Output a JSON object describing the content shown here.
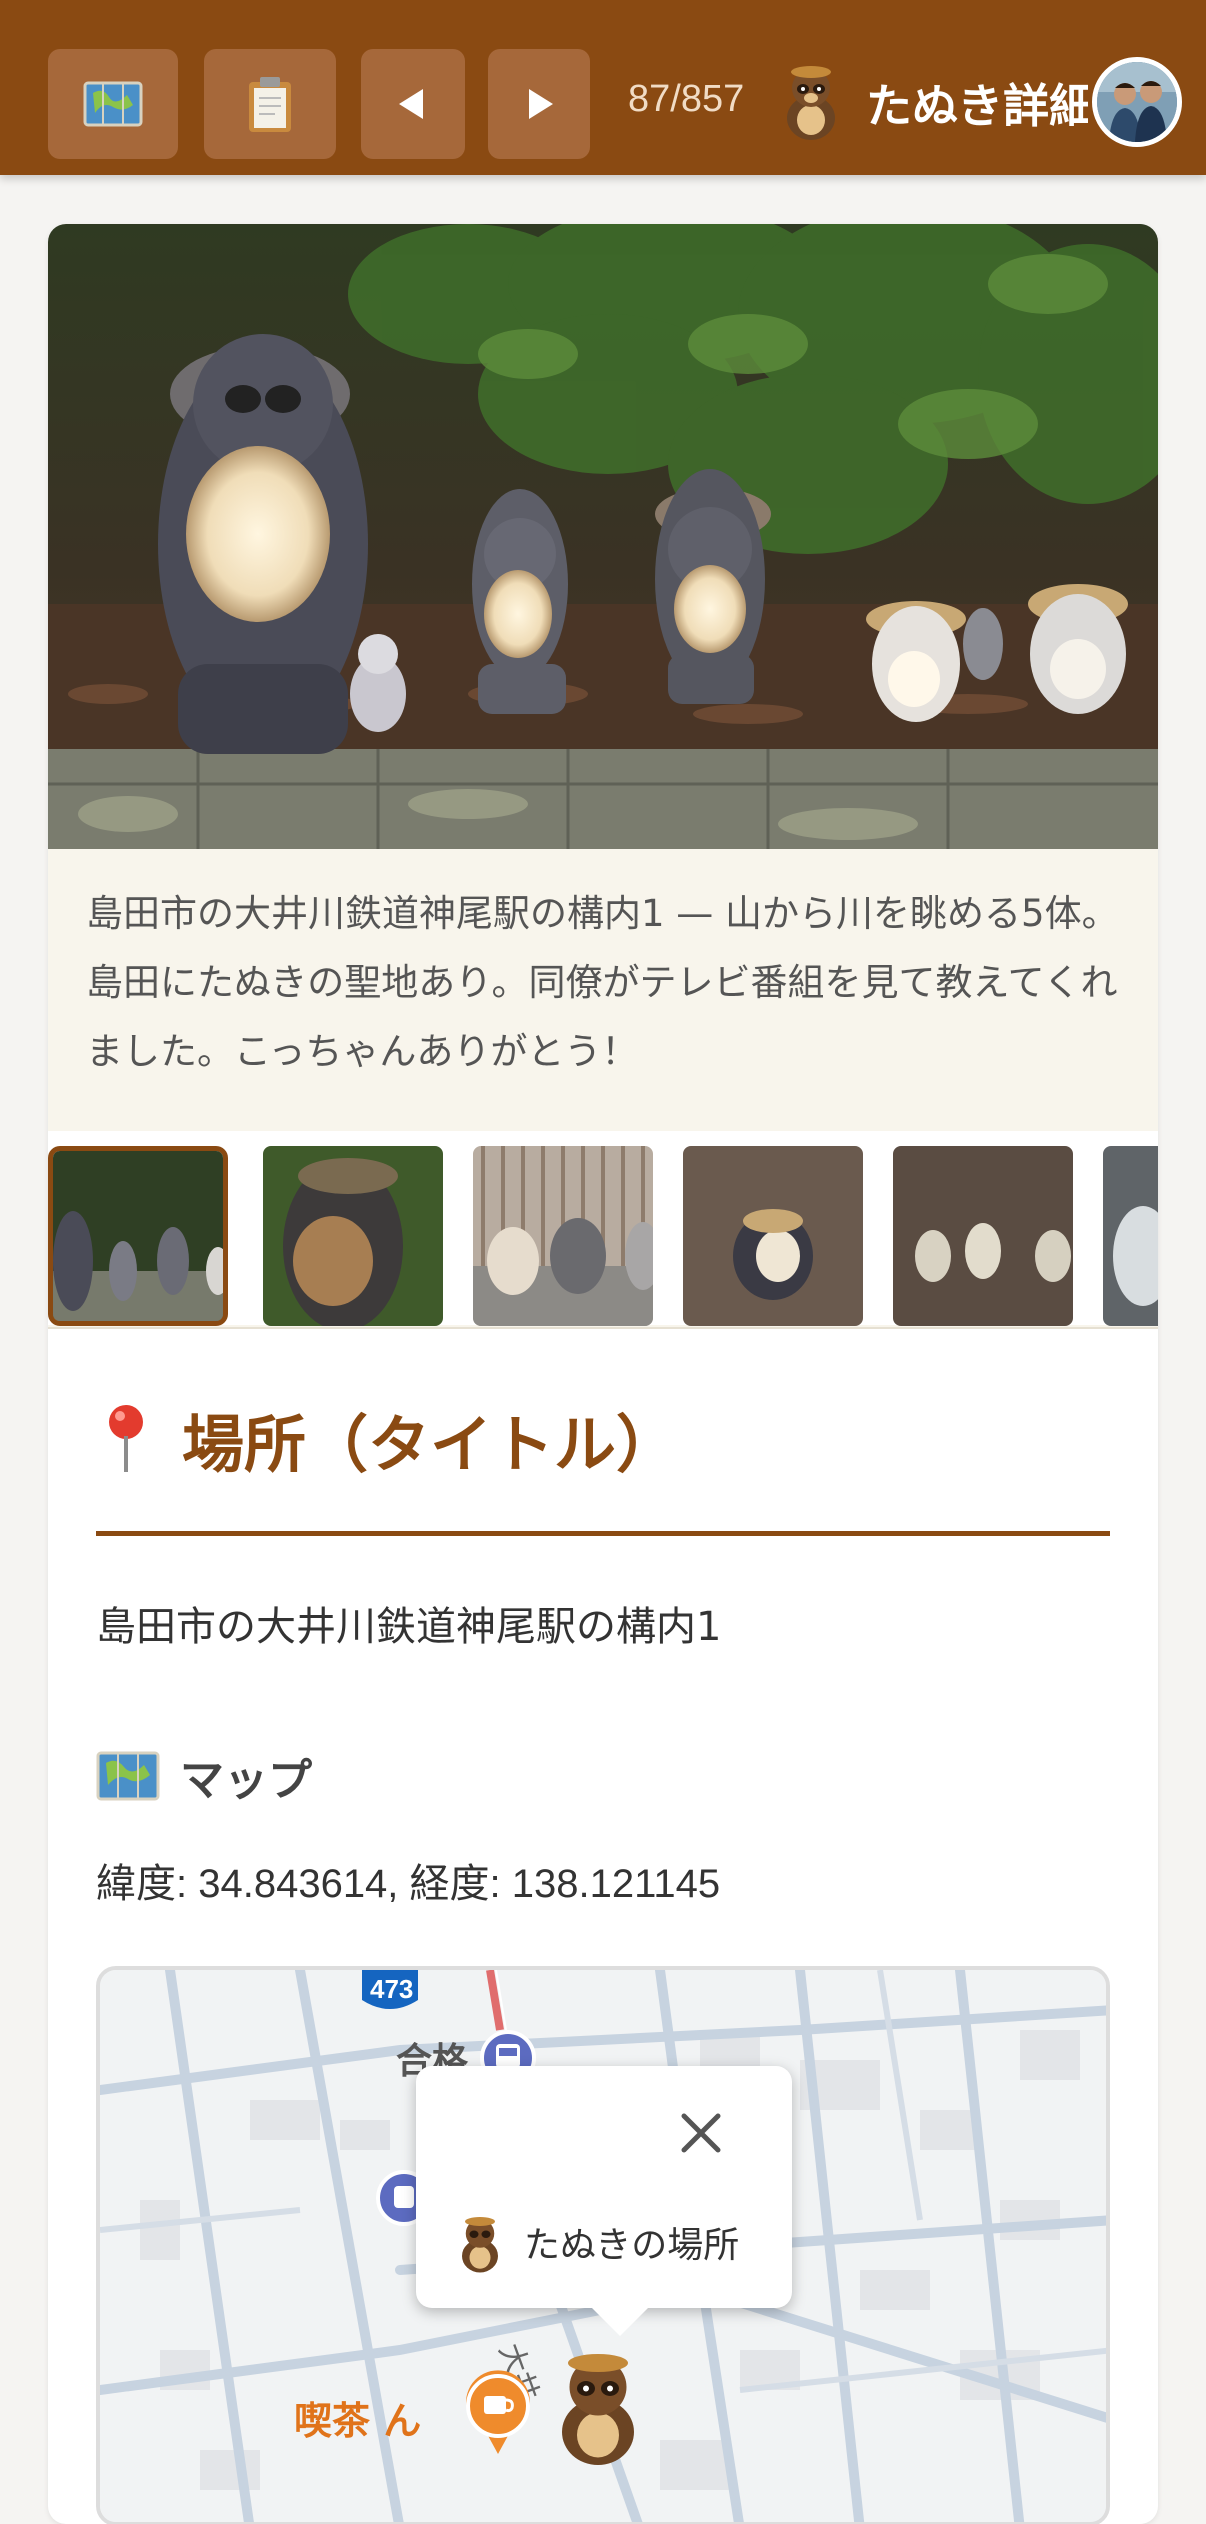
{
  "header": {
    "counter": "87/857",
    "title": "たぬき詳細",
    "buttons": {
      "map": "map-icon",
      "list": "clipboard-icon",
      "prev": "◀",
      "next": "▶"
    }
  },
  "photo": {
    "caption": "島田市の大井川鉄道神尾駅の構内1 — 山から川を眺める5体。島田にたぬきの聖地あり。同僚がテレビ番組を見て教えてくれました。こっちゃんありがとう！"
  },
  "location": {
    "heading": "場所（タイトル）",
    "text": "島田市の大井川鉄道神尾駅の構内1"
  },
  "map": {
    "heading": "マップ",
    "coords": "緯度: 34.843614, 経度: 138.121145",
    "route_label": "473",
    "place_label": "合格",
    "popup_label": "たぬきの場所",
    "poi_label": "喫茶 ん",
    "road_label": "大井"
  },
  "colors": {
    "brand": "#8a4a12",
    "button": "#a6683a",
    "caption_bg": "#f8f5ec"
  }
}
